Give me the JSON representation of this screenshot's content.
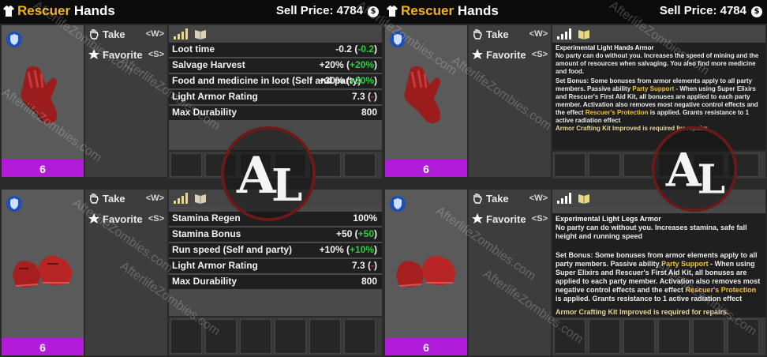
{
  "panels": [
    {
      "title_accent": "Rescuer",
      "title_rest": "Hands",
      "sell_label": "Sell Price:",
      "sell_value": "4784",
      "qty": "6",
      "take_label": "Take",
      "take_key": "<W>",
      "favorite_label": "Favorite",
      "favorite_key": "<S>",
      "stats": [
        {
          "label": "Loot time",
          "value": "-0.2",
          "paren": "-0.2",
          "delta_color": "green"
        },
        {
          "label": "Salvage Harvest",
          "value": "+20%",
          "paren": "+20%",
          "delta_color": "green"
        },
        {
          "label": "Food and medicine in loot (Self and party)",
          "value": "+30%",
          "paren": "+30%",
          "delta_color": "green"
        },
        {
          "label": "Light Armor Rating",
          "value": "7.3",
          "paren": "-",
          "delta_color": "red"
        },
        {
          "label": "Max Durability",
          "value": "800",
          "paren": "",
          "delta_color": ""
        }
      ]
    },
    {
      "title_accent": "Rescuer",
      "title_rest": "Hands",
      "sell_label": "Sell Price:",
      "sell_value": "4784",
      "qty": "6",
      "take_label": "Take",
      "take_key": "<W>",
      "favorite_label": "Favorite",
      "favorite_key": "<S>",
      "desc_title": "Experimental Light Hands Armor",
      "desc_text": "No party can do without you. Increases the speed of mining and the amount of resources when salvaging. You also find more medicine and food.",
      "desc_set_1": "Set Bonus: Some bonuses from armor elements apply to all party members. Passive ability ",
      "desc_set_hl1": "Party Support",
      "desc_set_2": " - When using Super Elixirs and Rescuer's First Aid Kit, all bonuses are applied to each party member. Activation also removes most negative control effects and the effect ",
      "desc_set_hl2": "Rescuer's Protection",
      "desc_set_3": " is applied. Grants resistance to 1 active radiation effect",
      "desc_req": "Armor Crafting Kit Improved is required for repairs."
    },
    {
      "qty": "6",
      "take_label": "Take",
      "take_key": "<W>",
      "favorite_label": "Favorite",
      "favorite_key": "<S>",
      "stats": [
        {
          "label": "Stamina Regen",
          "value": "100%",
          "paren": "",
          "delta_color": ""
        },
        {
          "label": "Stamina Bonus",
          "value": "+50",
          "paren": "+50",
          "delta_color": "green"
        },
        {
          "label": "Run speed (Self and party)",
          "value": "+10%",
          "paren": "+10%",
          "delta_color": "green"
        },
        {
          "label": "Light Armor Rating",
          "value": "7.3",
          "paren": "-",
          "delta_color": "red"
        },
        {
          "label": "Max Durability",
          "value": "800",
          "paren": "",
          "delta_color": ""
        }
      ]
    },
    {
      "qty": "6",
      "take_label": "Take",
      "take_key": "<W>",
      "favorite_label": "Favorite",
      "favorite_key": "<S>",
      "desc_title": "Experimental Light Legs Armor",
      "desc_text": "No party can do without you. Increases stamina, safe fall height and running speed",
      "desc_set_1": "Set Bonus: Some bonuses from armor elements apply to all party members. Passive ability ",
      "desc_set_hl1": "Party Support",
      "desc_set_2": " - When using Super Elixirs and Rescuer's First Aid Kit, all bonuses are applied to each party member. Activation also removes most negative control effects and the effect ",
      "desc_set_hl2": "Rescuer's Protection",
      "desc_set_3": " is applied. Grants resistance to 1 active radiation effect",
      "desc_req": "Armor Crafting Kit Improved is required for repairs."
    }
  ],
  "watermark": "AfterlifeZombies.com",
  "colors": {
    "title_accent": "#f0b21c",
    "quantity_bar": "#b11cd9",
    "positive": "#2ecc40",
    "negative": "#e23030",
    "highlight": "#f0c040"
  },
  "icons": [
    "shirt-icon",
    "coin-icon",
    "shield-icon",
    "gloves-image",
    "shoes-image",
    "hand-icon",
    "star-icon",
    "signal-icon",
    "book-icon",
    "logo-icon"
  ]
}
